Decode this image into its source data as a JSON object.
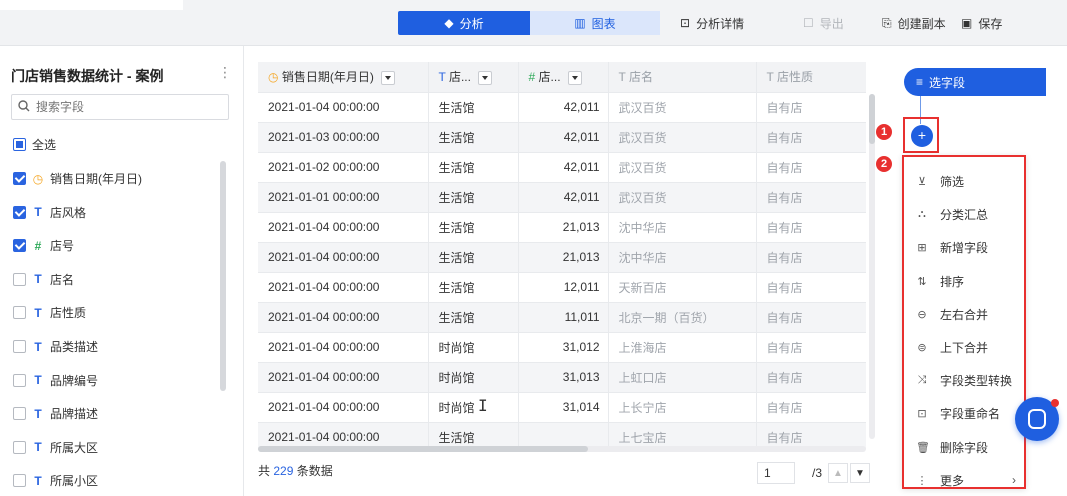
{
  "toolbar": {
    "analyze_label": "分析",
    "chart_label": "图表",
    "detail_label": "分析详情",
    "export_label": "导出",
    "copy_label": "创建副本",
    "save_label": "保存"
  },
  "left_panel": {
    "title": "门店销售数据统计 - 案例",
    "search_placeholder": "搜索字段",
    "select_all": "全选",
    "fields": [
      {
        "label": "销售日期(年月日)",
        "type": "date",
        "checked": true
      },
      {
        "label": "店风格",
        "type": "text",
        "checked": true
      },
      {
        "label": "店号",
        "type": "number",
        "checked": true
      },
      {
        "label": "店名",
        "type": "text",
        "checked": false
      },
      {
        "label": "店性质",
        "type": "text",
        "checked": false
      },
      {
        "label": "品类描述",
        "type": "text",
        "checked": false
      },
      {
        "label": "品牌编号",
        "type": "text",
        "checked": false
      },
      {
        "label": "品牌描述",
        "type": "text",
        "checked": false
      },
      {
        "label": "所属大区",
        "type": "text",
        "checked": false
      },
      {
        "label": "所属小区",
        "type": "text",
        "checked": false
      }
    ]
  },
  "table": {
    "headers": [
      "销售日期(年月日)",
      "店...",
      "店...",
      "店名",
      "店性质"
    ],
    "rows": [
      [
        "2021-01-04 00:00:00",
        "生活馆",
        "42,011",
        "武汉百货",
        "自有店"
      ],
      [
        "2021-01-03 00:00:00",
        "生活馆",
        "42,011",
        "武汉百货",
        "自有店"
      ],
      [
        "2021-01-02 00:00:00",
        "生活馆",
        "42,011",
        "武汉百货",
        "自有店"
      ],
      [
        "2021-01-01 00:00:00",
        "生活馆",
        "42,011",
        "武汉百货",
        "自有店"
      ],
      [
        "2021-01-04 00:00:00",
        "生活馆",
        "21,013",
        "沈中华店",
        "自有店"
      ],
      [
        "2021-01-04 00:00:00",
        "生活馆",
        "21,013",
        "沈中华店",
        "自有店"
      ],
      [
        "2021-01-04 00:00:00",
        "生活馆",
        "12,011",
        "天新百店",
        "自有店"
      ],
      [
        "2021-01-04 00:00:00",
        "生活馆",
        "11,011",
        "北京一期（百货）",
        "自有店"
      ],
      [
        "2021-01-04 00:00:00",
        "时尚馆",
        "31,012",
        "上淮海店",
        "自有店"
      ],
      [
        "2021-01-04 00:00:00",
        "时尚馆",
        "31,013",
        "上虹口店",
        "自有店"
      ],
      [
        "2021-01-04 00:00:00",
        "时尚馆",
        "31,014",
        "上长宁店",
        "自有店"
      ],
      [
        "2021-01-04 00:00:00",
        "生活馆",
        "",
        "上七宝店",
        "自有店"
      ]
    ]
  },
  "footer": {
    "prefix": "共",
    "count": "229",
    "suffix": "条数据",
    "page": "1",
    "total_pages": "/3"
  },
  "ops": {
    "select_field": "选字段",
    "plus": "+",
    "badge1": "1",
    "badge2": "2",
    "menu": [
      "筛选",
      "分类汇总",
      "新增字段",
      "排序",
      "左右合并",
      "上下合并",
      "字段类型转换",
      "字段重命名",
      "删除字段",
      "更多"
    ]
  },
  "colors": {
    "accent": "#1f5fe0",
    "highlight": "#e8302f"
  }
}
